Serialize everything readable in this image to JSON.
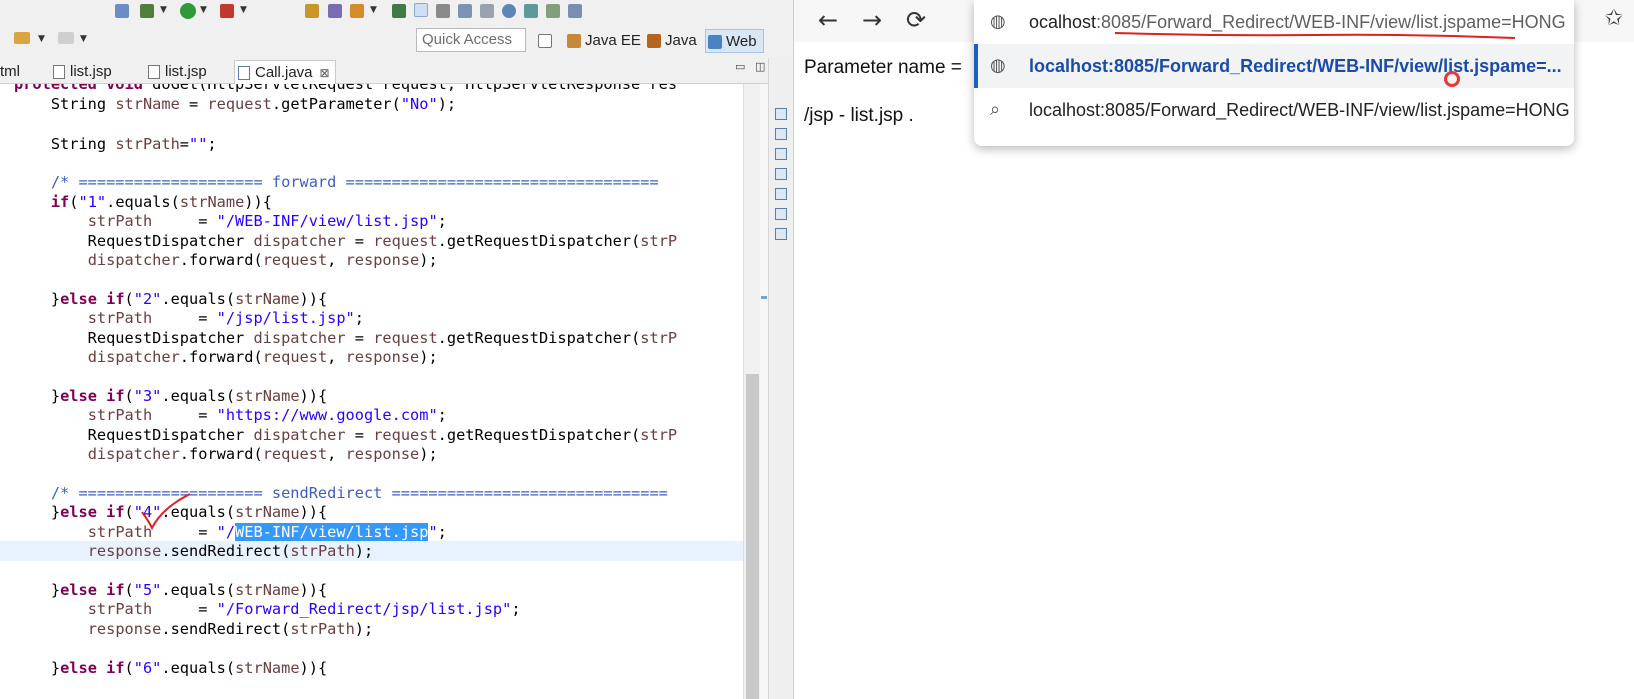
{
  "eclipse": {
    "quick_access_placeholder": "Quick Access",
    "perspectives": [
      "Java EE",
      "Java",
      "Web"
    ],
    "tabs": [
      {
        "label": "tml"
      },
      {
        "label": "list.jsp"
      },
      {
        "label": "list.jsp"
      },
      {
        "label": "Call.java",
        "close": "⊠"
      }
    ],
    "code": {
      "l0a": "protected void ",
      "l0b": "doGet(HttpServletRequest request, HttpServletResponse res",
      "get_param": "getParameter(",
      "s_no": "\"No\"",
      "empty_str": "\"\"",
      "comment_forward": "/* ==================== forward ==================================",
      "comment_redirect": "/* ==================== sendRedirect ==============================",
      "s1": "\"1\"",
      "s2": "\"2\"",
      "s3": "\"3\"",
      "s4": "\"4\"",
      "s5": "\"5\"",
      "s6": "\"6\"",
      "p1": "\"/WEB-INF/view/list.jsp\"",
      "p2": "\"/jsp/list.jsp\"",
      "p3": "\"https://www.google.com\"",
      "p4_pre": "\"/",
      "p4_sel": "WEB-INF/view/list.jsp",
      "p4_post": "\"",
      "p5": "\"/Forward_Redirect/jsp/list.jsp\""
    }
  },
  "browser": {
    "nav_back": "←",
    "nav_forward": "→",
    "nav_reload": "⟳",
    "omnibox": {
      "input_host": "ocalhost",
      "input_path": ":8085/Forward_Redirect/WEB-INF/view/list.jspame=HONG",
      "suggestion_1": "localhost:8085/Forward_Redirect/WEB-INF/view/list.jspame=...",
      "suggestion_2": "localhost:8085/Forward_Redirect/WEB-INF/view/list.jspame=HONG"
    },
    "page": {
      "param_label": "Parameter name =",
      "line2": "/jsp - list.jsp ."
    }
  }
}
